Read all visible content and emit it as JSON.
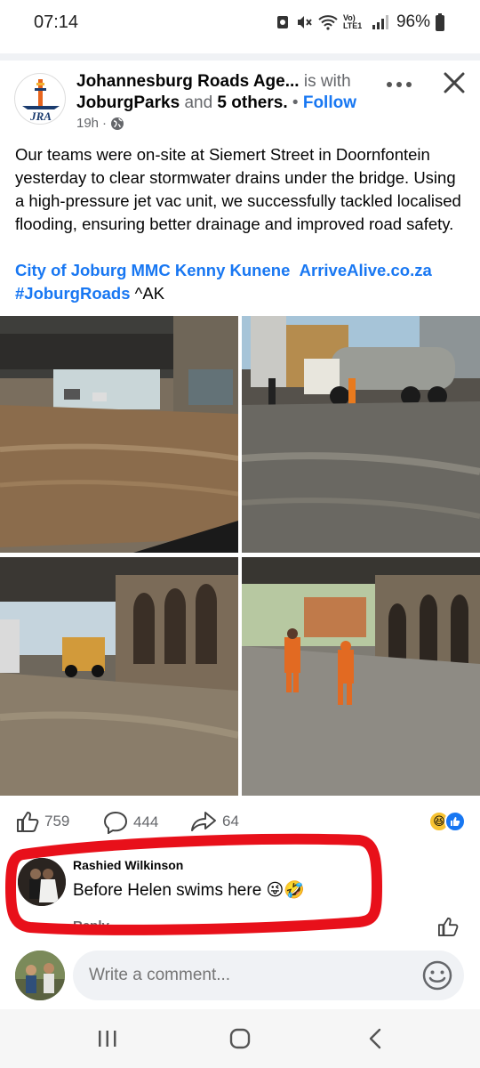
{
  "status_bar": {
    "time": "07:14",
    "network_label": "Vo) LTE1",
    "battery": "96%"
  },
  "post": {
    "author": "Johannesburg Roads Age...",
    "with_text": "is with",
    "tagged": "JoburgParks",
    "and_text": "and",
    "others": "5 others.",
    "follow_label": "Follow",
    "time_ago": "19h",
    "avatar_logo_text": "JRA",
    "body": "Our teams were on-site at Siemert Street in Doornfontein yesterday to clear stormwater drains under the bridge. Using a high-pressure jet vac unit, we successfully tackled localised flooding, ensuring better drainage and improved road safety.",
    "links": [
      "City of Joburg MMC Kenny Kunene",
      "ArriveAlive.co.za",
      "#JoburgRoads"
    ],
    "signoff": "^AK"
  },
  "photos": [
    {
      "desc": "flooded-road-under-bridge-photo"
    },
    {
      "desc": "jet-vac-truck-street-photo"
    },
    {
      "desc": "truck-under-bridge-photo"
    },
    {
      "desc": "workers-under-bridge-photo"
    }
  ],
  "reactions": {
    "likes": "759",
    "comments": "444",
    "shares": "64"
  },
  "comment": {
    "author": "Rashied Wilkinson",
    "text": "Before Helen swims here 😜🤣",
    "reply_label": "Reply"
  },
  "composer": {
    "placeholder": "Write a comment..."
  },
  "colors": {
    "link": "#1877f2",
    "muted": "#65676b",
    "annotation_red": "#e8101a"
  }
}
